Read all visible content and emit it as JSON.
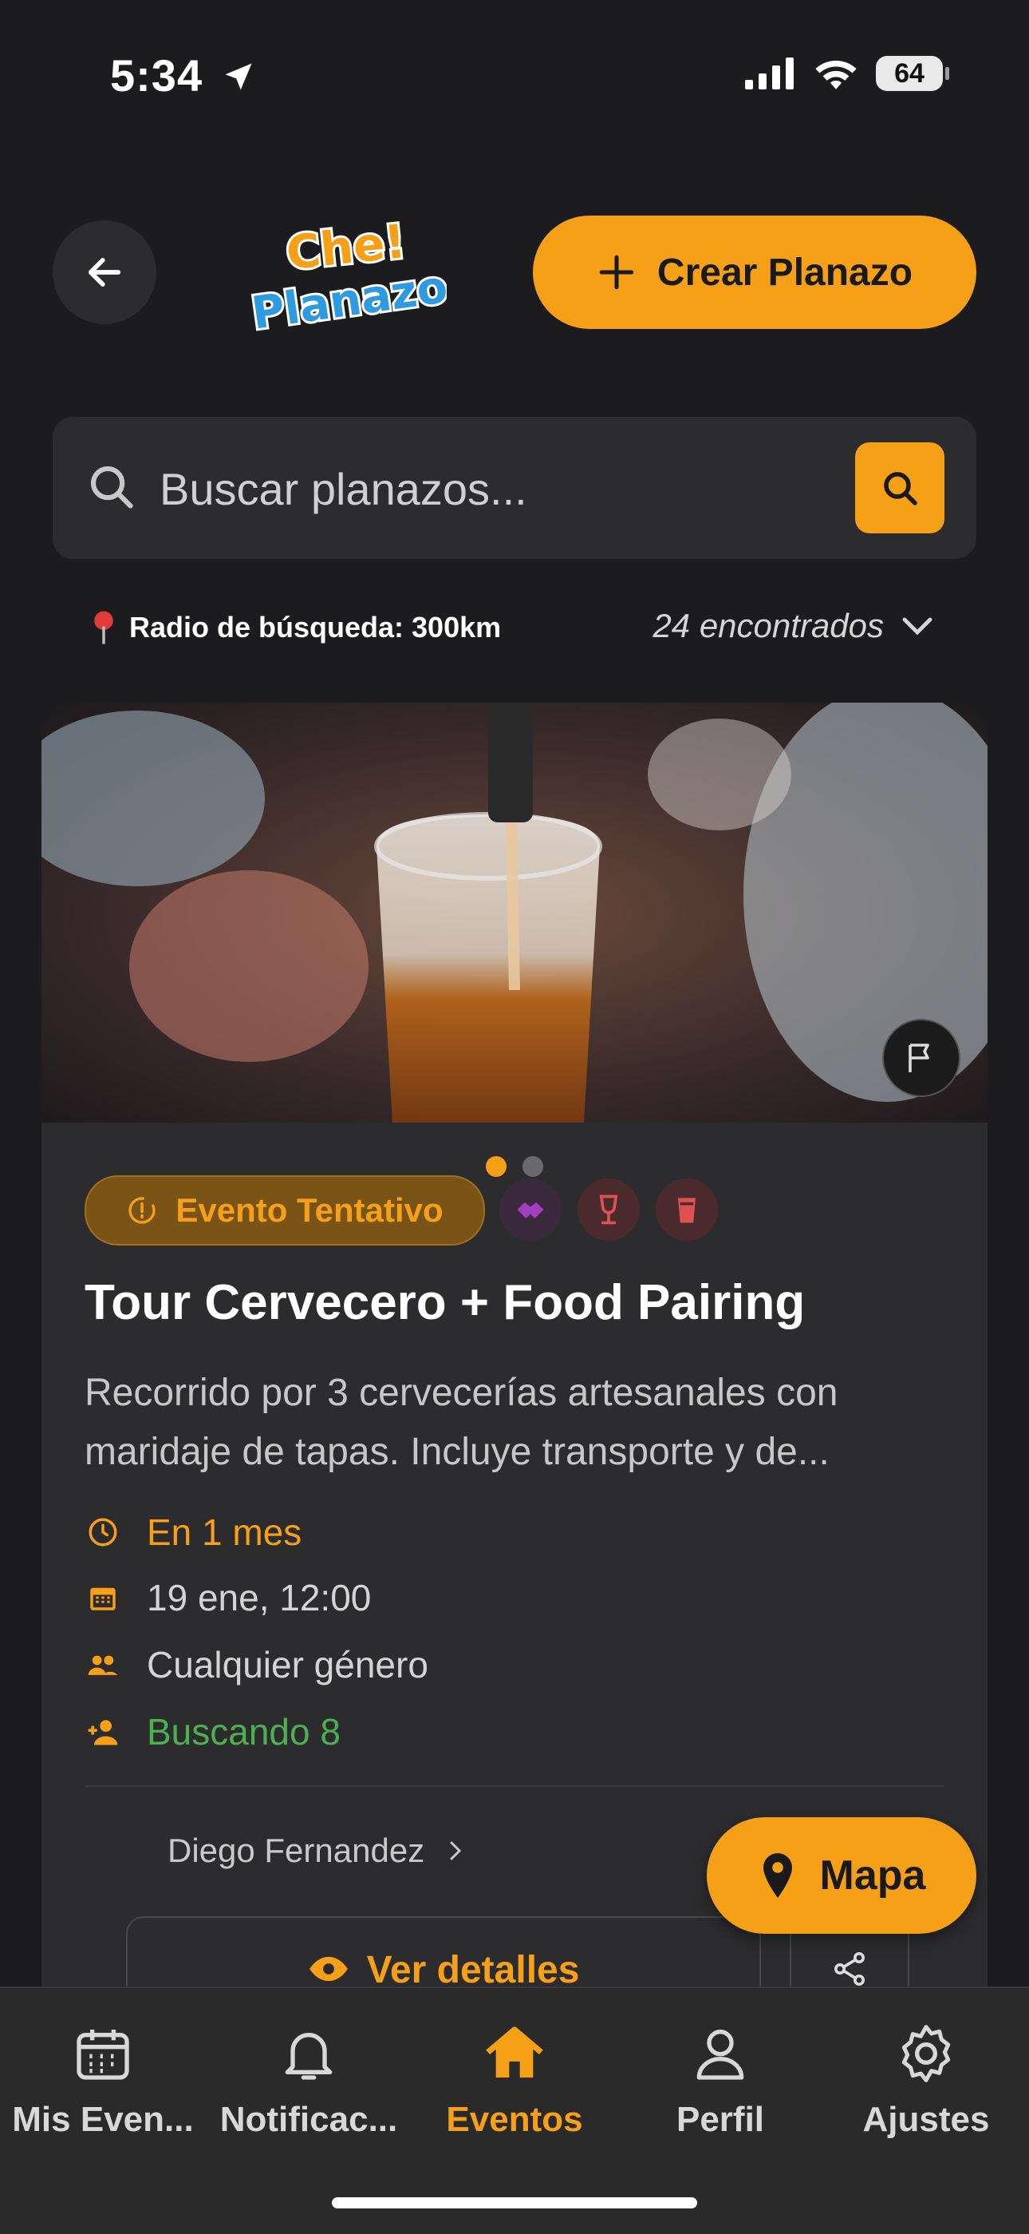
{
  "status": {
    "time": "5:34",
    "battery": "64"
  },
  "header": {
    "create_label": "Crear Planazo",
    "logo_line1": "Che!",
    "logo_line2": "Planazo"
  },
  "search": {
    "placeholder": "Buscar planazos..."
  },
  "filters": {
    "radius_label": "Radio de búsqueda: 300km",
    "found_label": "24 encontrados"
  },
  "event": {
    "badge": "Evento Tentativo",
    "title": "Tour Cervecero + Food Pairing",
    "description": "Recorrido por 3 cervecerías artesanales con maridaje de tapas. Incluye transporte y de...",
    "when_relative": "En 1 mes",
    "date": "19 ene, 12:00",
    "gender": "Cualquier género",
    "looking_for": "Buscando 8",
    "organizer": "Diego Fernandez",
    "details_label": "Ver detalles",
    "carousel": {
      "count": 2,
      "active": 0
    },
    "categories": [
      "handshake-icon",
      "wine-glass-icon",
      "beer-glass-icon"
    ]
  },
  "map_button": {
    "label": "Mapa"
  },
  "tabs": [
    {
      "label": "Mis Even...",
      "icon": "calendar-icon",
      "active": false
    },
    {
      "label": "Notificac...",
      "icon": "bell-icon",
      "active": false
    },
    {
      "label": "Eventos",
      "icon": "home-icon",
      "active": true
    },
    {
      "label": "Perfil",
      "icon": "person-icon",
      "active": false
    },
    {
      "label": "Ajustes",
      "icon": "gear-icon",
      "active": false
    }
  ],
  "colors": {
    "accent": "#f5a016",
    "success": "#4caf50",
    "background": "#1c1c1e",
    "card": "#2c2c2e"
  }
}
